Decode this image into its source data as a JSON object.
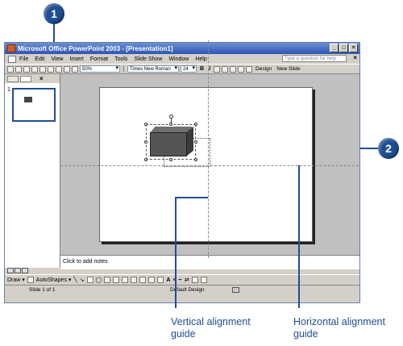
{
  "callouts": {
    "first": "1",
    "second": "2"
  },
  "window": {
    "title": "Microsoft Office PowerPoint 2003 - [Presentation1]",
    "minimize": "_",
    "maximize": "□",
    "close": "✕"
  },
  "menu": {
    "items": [
      "File",
      "Edit",
      "View",
      "Insert",
      "Format",
      "Tools",
      "Slide Show",
      "Window",
      "Help"
    ],
    "help_placeholder": "Type a question for help"
  },
  "toolbar": {
    "zoom": "50%",
    "font_name": "Times New Roman",
    "font_size": "24",
    "bold": "B",
    "italic": "I",
    "design": "Design",
    "new_slide": "New Slide"
  },
  "slides_pane": {
    "slide_number": "1"
  },
  "notes": {
    "placeholder": "Click to add notes"
  },
  "drawing_toolbar": {
    "draw": "Draw ▾",
    "autoshapes": "AutoShapes ▾"
  },
  "status": {
    "slide": "Slide 1 of 1",
    "design": "Default Design"
  },
  "labels": {
    "vertical": "Vertical alignment\nguide",
    "horizontal": "Horizontal alignment\nguide"
  },
  "colors": {
    "callout": "#1f4f93",
    "titlebar": "#2c56b8",
    "workspace": "#c0c0c0"
  }
}
